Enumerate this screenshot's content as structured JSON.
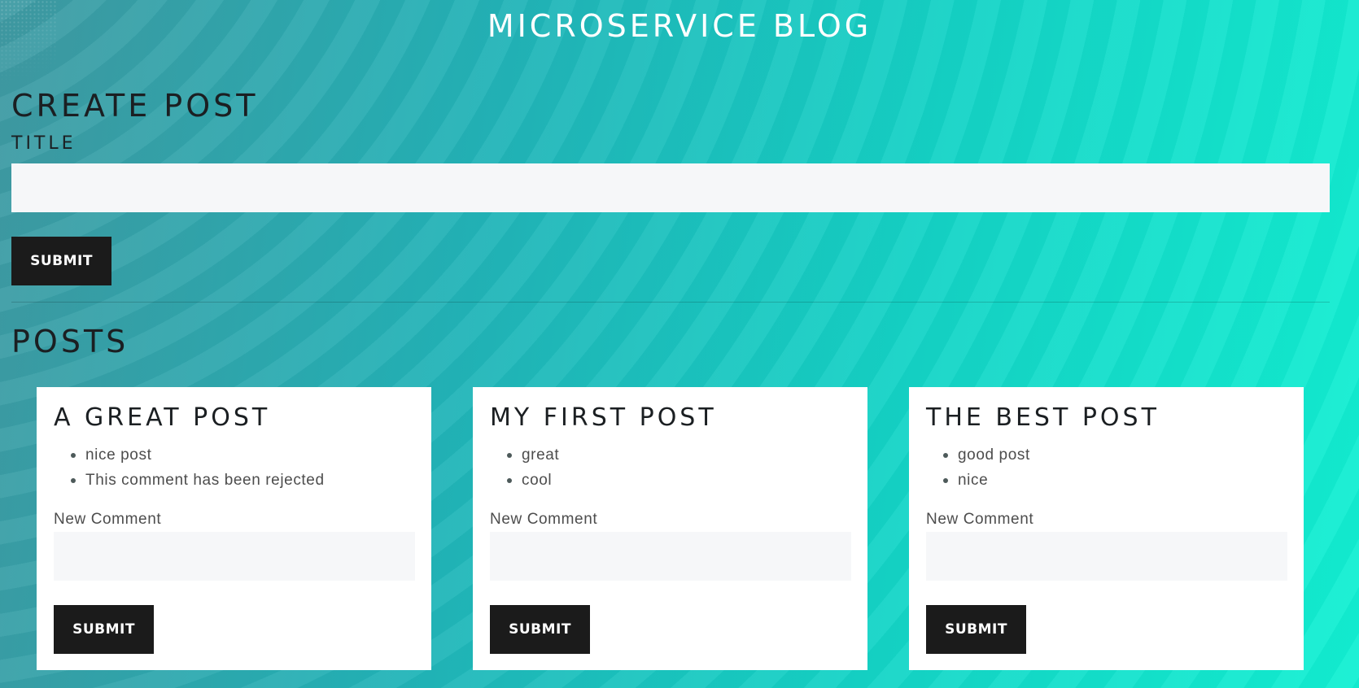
{
  "header": {
    "title": "MICROSERVICE BLOG"
  },
  "create_post": {
    "heading": "CREATE POST",
    "title_label": "TITLE",
    "title_value": "",
    "submit_label": "SUBMIT"
  },
  "posts_section": {
    "heading": "POSTS"
  },
  "posts": [
    {
      "title": "A GREAT POST",
      "comments": [
        "nice post",
        "This comment has been rejected"
      ],
      "new_comment_label": "New Comment",
      "new_comment_value": "",
      "submit_label": "SUBMIT"
    },
    {
      "title": "MY FIRST POST",
      "comments": [
        "great",
        "cool"
      ],
      "new_comment_label": "New Comment",
      "new_comment_value": "",
      "submit_label": "SUBMIT"
    },
    {
      "title": "THE BEST POST",
      "comments": [
        "good post",
        "nice"
      ],
      "new_comment_label": "New Comment",
      "new_comment_value": "",
      "submit_label": "SUBMIT"
    }
  ],
  "colors": {
    "button_bg": "#1b1b1b",
    "input_bg": "#f6f7f9",
    "card_bg": "#ffffff",
    "bg_gradient_start": "#3f9aa3",
    "bg_gradient_end": "#12f0d3"
  }
}
